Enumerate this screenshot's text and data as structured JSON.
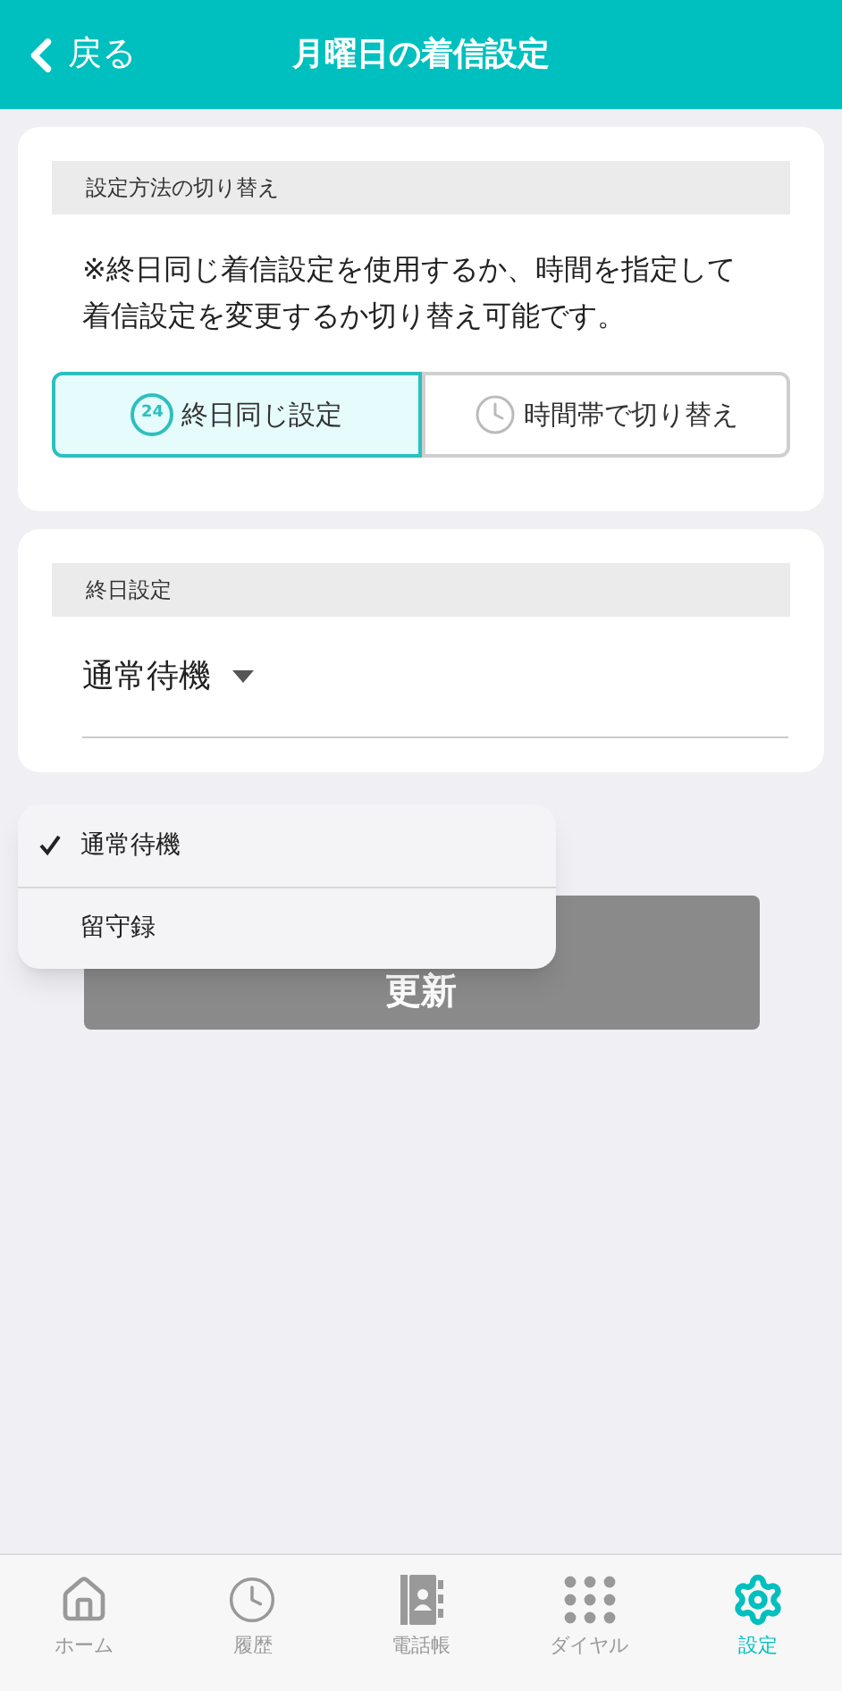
{
  "header": {
    "back": "戻る",
    "title": "月曜日の着信設定"
  },
  "mode_card": {
    "heading": "設定方法の切り替え",
    "note": "※終日同じ着信設定を使用するか、時間を指定して着信設定を変更するか切り替え可能です。",
    "options": [
      {
        "kind": "allday",
        "icon_text": "24",
        "label": "終日同じ設定",
        "selected": true
      },
      {
        "kind": "timed",
        "label": "時間帯で切り替え",
        "selected": false
      }
    ]
  },
  "allday_card": {
    "heading": "終日設定",
    "select_value": "通常待機"
  },
  "update_button": {
    "label": "更新",
    "disabled": true
  },
  "dropdown_menu": {
    "items": [
      {
        "label": "通常待機",
        "selected": true
      },
      {
        "label": "留守録",
        "selected": false
      }
    ]
  },
  "tab_bar": [
    {
      "kind": "home",
      "label": "ホーム",
      "selected": false
    },
    {
      "kind": "history",
      "label": "履歴",
      "selected": false
    },
    {
      "kind": "contacts",
      "label": "電話帳",
      "selected": false
    },
    {
      "kind": "dial",
      "label": "ダイヤル",
      "selected": false
    },
    {
      "kind": "settings",
      "label": "設定",
      "selected": true
    }
  ]
}
